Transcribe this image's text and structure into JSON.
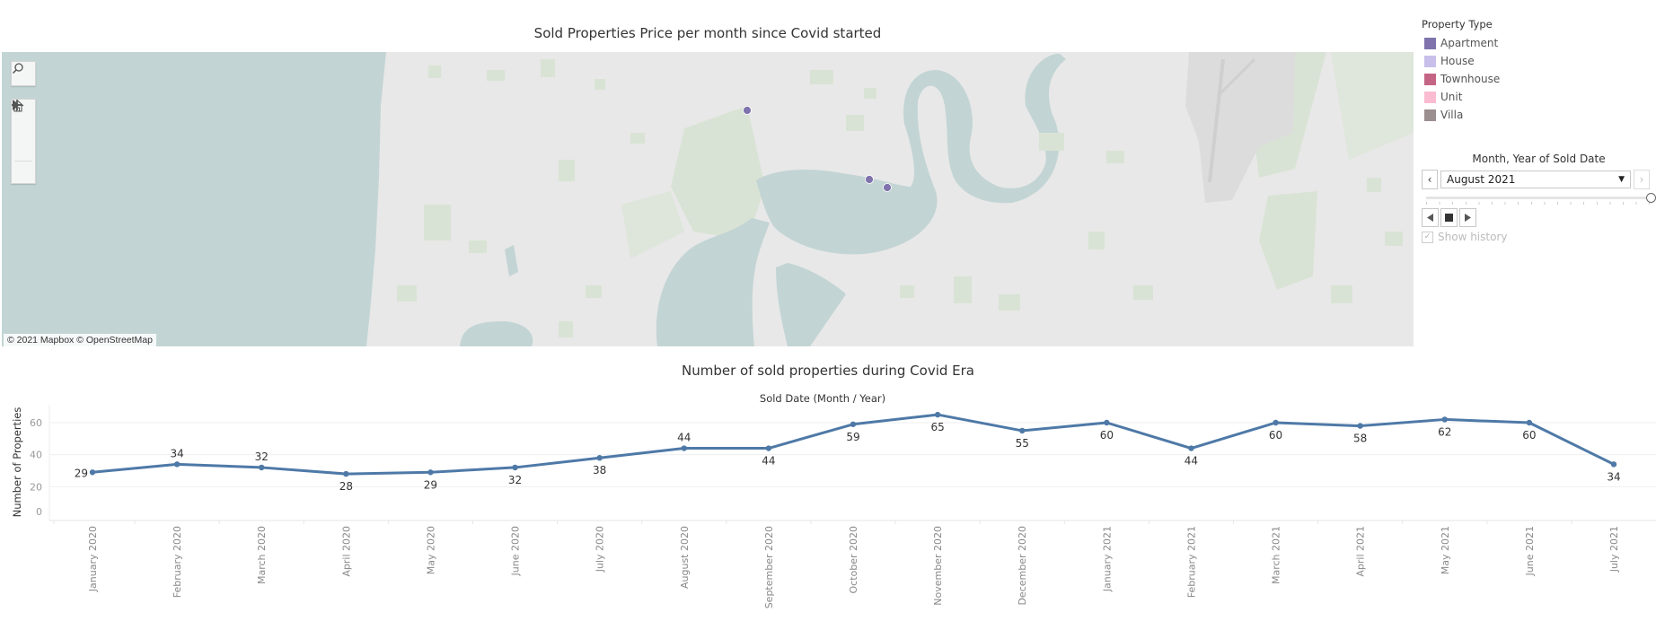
{
  "map": {
    "title": "Sold Properties Price per month since Covid started",
    "attribution": "© 2021 Mapbox  © OpenStreetMap",
    "controls": [
      {
        "name": "search",
        "icon": "search-icon"
      },
      {
        "name": "zoom-in",
        "icon": "plus-icon"
      },
      {
        "name": "zoom-out",
        "icon": "minus-icon"
      },
      {
        "name": "home",
        "icon": "home-icon"
      },
      {
        "name": "expand",
        "icon": "play-icon"
      }
    ],
    "points": [
      {
        "property_type": "Apartment"
      },
      {
        "property_type": "Apartment"
      },
      {
        "property_type": "Apartment"
      }
    ],
    "colors": {
      "water": "#c3d4d4",
      "land": "#e8e8e8",
      "park": "#d9e3d5",
      "airport": "#dcdcdc"
    }
  },
  "legend": {
    "title": "Property Type",
    "items": [
      {
        "label": "Apartment",
        "color": "#7f73ad"
      },
      {
        "label": "House",
        "color": "#c8c0ea"
      },
      {
        "label": "Townhouse",
        "color": "#c46586"
      },
      {
        "label": "Unit",
        "color": "#fbbcd2"
      },
      {
        "label": "Villa",
        "color": "#9c8f8f"
      }
    ]
  },
  "filter": {
    "title": "Month, Year of Sold Date",
    "selected": "August 2021",
    "prev_icon": "chevron-left-icon",
    "next_icon": "chevron-right-icon",
    "dropdown_icon": "caret-down-icon",
    "slider_position": 1.0,
    "show_history_label": "Show history",
    "show_history_checked": true,
    "show_history_enabled": false
  },
  "chart_data": {
    "type": "line",
    "title": "Number of sold properties during Covid Era",
    "xlabel": "Sold Date (Month / Year)",
    "ylabel": "Number of Properties",
    "ylim": [
      0,
      70
    ],
    "yticks": [
      0,
      20,
      40,
      60
    ],
    "grid": true,
    "line_color": "#4e79a7",
    "categories": [
      "January 2020",
      "February 2020",
      "March 2020",
      "April 2020",
      "May 2020",
      "June 2020",
      "July 2020",
      "August 2020",
      "September 2020",
      "October 2020",
      "November 2020",
      "December 2020",
      "January 2021",
      "February 2021",
      "March 2021",
      "April 2021",
      "May 2021",
      "June 2021",
      "July 2021"
    ],
    "values": [
      29,
      34,
      32,
      28,
      29,
      32,
      38,
      44,
      44,
      59,
      65,
      55,
      60,
      44,
      60,
      58,
      62,
      60,
      34
    ],
    "label_positions": [
      "left",
      "above",
      "above",
      "below",
      "below",
      "below",
      "below",
      "above",
      "below",
      "below",
      "below",
      "below",
      "below",
      "below",
      "below",
      "below",
      "below",
      "below",
      "below"
    ]
  }
}
